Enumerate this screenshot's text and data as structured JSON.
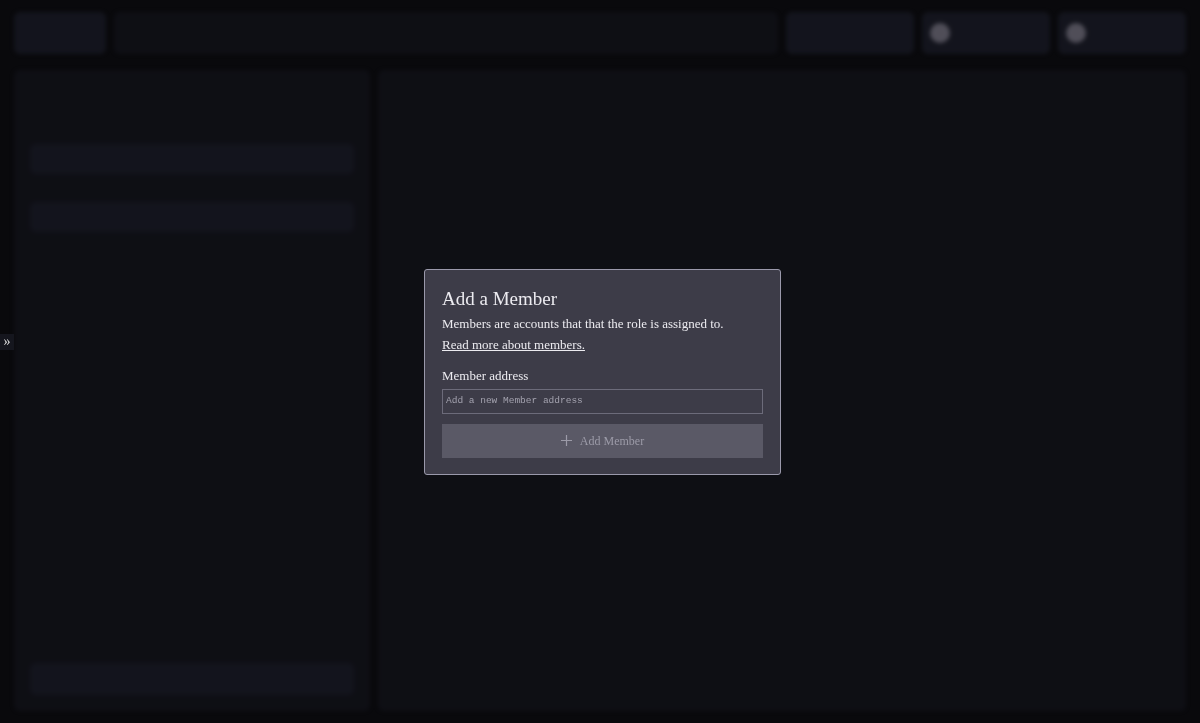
{
  "sidebar_toggle": {
    "label": "»"
  },
  "dialog": {
    "title": "Add a Member",
    "description": "Members are accounts that that the role is assigned to.",
    "link": "Read more about members.",
    "field": {
      "label": "Member address",
      "placeholder": "Add a new Member address"
    },
    "button": {
      "label": "Add Member",
      "disabled": true
    }
  }
}
